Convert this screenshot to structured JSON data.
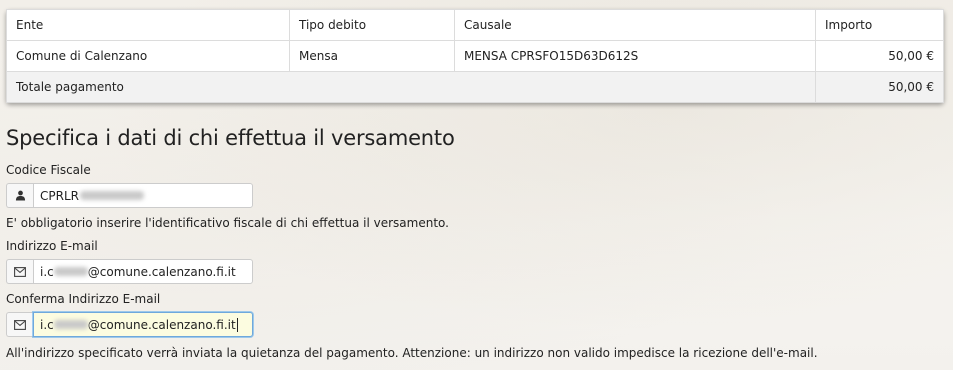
{
  "table": {
    "headers": [
      "Ente",
      "Tipo debito",
      "Causale",
      "Importo"
    ],
    "rows": [
      {
        "ente": "Comune di Calenzano",
        "tipo": "Mensa",
        "causale": "MENSA CPRSFO15D63D612S",
        "importo": "50,00 €"
      }
    ],
    "total_label": "Totale pagamento",
    "total_value": "50,00 €"
  },
  "form": {
    "title": "Specifica i dati di chi effettua il versamento",
    "codice_fiscale": {
      "label": "Codice Fiscale",
      "value_visible": "CPRLR",
      "icon": "user-icon"
    },
    "codice_fiscale_help": "E' obbligatorio inserire l'identificativo fiscale di chi effettua il versamento.",
    "email": {
      "label": "Indirizzo E-mail",
      "value_prefix": "i.c",
      "value_suffix": "@comune.calenzano.fi.it",
      "icon": "envelope-icon"
    },
    "email_confirm": {
      "label": "Conferma Indirizzo E-mail",
      "value_prefix": "i.c",
      "value_suffix": "@comune.calenzano.fi.it",
      "icon": "envelope-icon"
    },
    "email_help": "All'indirizzo specificato verrà inviata la quietanza del pagamento. Attenzione: un indirizzo non valido impedisce la ricezione dell'e-mail."
  }
}
